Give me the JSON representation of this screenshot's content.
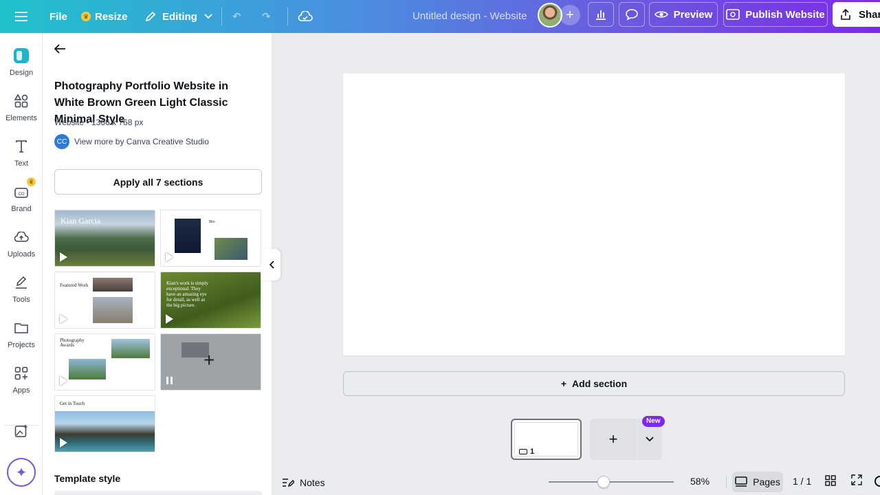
{
  "topbar": {
    "file_label": "File",
    "resize_label": "Resize",
    "editing_label": "Editing",
    "doc_title": "Untitled design - Website",
    "preview_label": "Preview",
    "publish_label": "Publish Website",
    "share_label": "Share"
  },
  "rail": {
    "items": [
      {
        "label": "Design"
      },
      {
        "label": "Elements"
      },
      {
        "label": "Text"
      },
      {
        "label": "Brand"
      },
      {
        "label": "Uploads"
      },
      {
        "label": "Tools"
      },
      {
        "label": "Projects"
      },
      {
        "label": "Apps"
      }
    ]
  },
  "panel": {
    "template_title": "Photography Portfolio Website in White Brown Green Light Classic Minimal Style",
    "meta": "Website • 1366 x 768 px",
    "creator_initials": "CC",
    "creator_link": "View more by Canva Creative Studio",
    "apply_label": "Apply all 7 sections",
    "thumbnails": {
      "hero_name": "Kian Garcia",
      "bio_label": "Bio",
      "featured_label": "Featured Work",
      "quote_text": "Kian's work is simply exceptional. They have an amazing eye for detail, as well as the big picture.",
      "awards_label": "Photography Awards",
      "touch_label": "Get in Touch"
    },
    "style_title": "Template style"
  },
  "canvas": {
    "add_section_label": "Add section",
    "page_number": "1",
    "new_badge": "New"
  },
  "bottombar": {
    "notes_label": "Notes",
    "zoom_value": "58%",
    "zoom_fraction": 0.44,
    "pages_label": "Pages",
    "page_count": "1 / 1"
  }
}
